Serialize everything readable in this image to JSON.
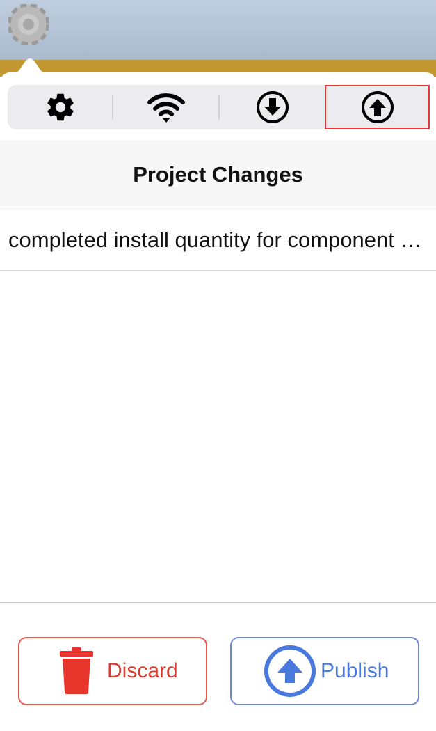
{
  "toolbar": {
    "tabs": [
      {
        "icon": "gear-icon",
        "name": "settings"
      },
      {
        "icon": "wifi-icon",
        "name": "sync"
      },
      {
        "icon": "download-circle-icon",
        "name": "download"
      },
      {
        "icon": "upload-circle-icon",
        "name": "upload",
        "selected": true
      }
    ]
  },
  "header": {
    "title": "Project Changes"
  },
  "changes": [
    {
      "text": "completed install quantity for component a…"
    }
  ],
  "actions": {
    "discard_label": "Discard",
    "publish_label": "Publish"
  },
  "colors": {
    "topbar": "#b5c5d7",
    "goldbar": "#c3972f",
    "discard": "#db3a2f",
    "publish": "#4a79dd",
    "selected_outline": "#e8353a"
  }
}
